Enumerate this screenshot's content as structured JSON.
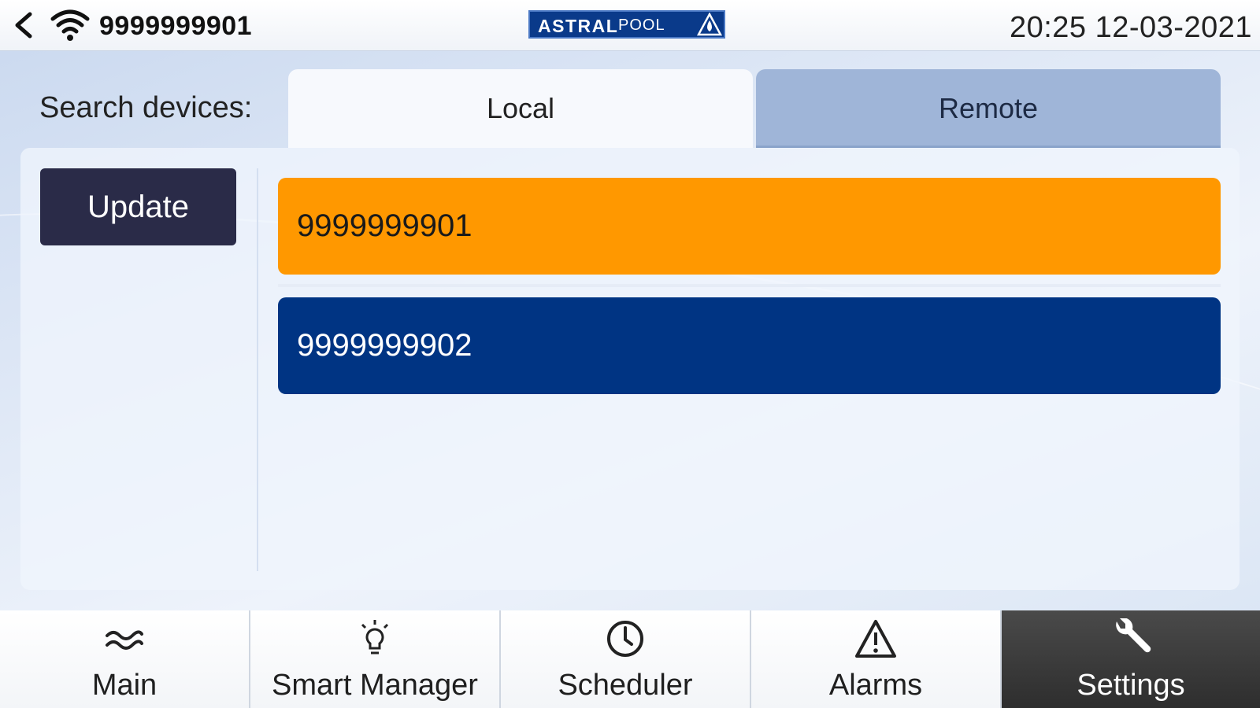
{
  "header": {
    "device_id": "9999999901",
    "logo_primary": "ASTRAL",
    "logo_secondary": "POOL",
    "datetime": "20:25 12-03-2021"
  },
  "search": {
    "label": "Search devices:",
    "tabs": [
      {
        "label": "Local",
        "selected": true
      },
      {
        "label": "Remote",
        "selected": false
      }
    ]
  },
  "actions": {
    "update_label": "Update"
  },
  "devices": [
    {
      "id": "9999999901",
      "state": "selected",
      "color": "#ff9800"
    },
    {
      "id": "9999999902",
      "state": "available",
      "color": "#003483"
    }
  ],
  "nav": [
    {
      "label": "Main",
      "icon": "waves-icon",
      "active": false
    },
    {
      "label": "Smart Manager",
      "icon": "lightbulb-icon",
      "active": false
    },
    {
      "label": "Scheduler",
      "icon": "clock-icon",
      "active": false
    },
    {
      "label": "Alarms",
      "icon": "warning-icon",
      "active": false
    },
    {
      "label": "Settings",
      "icon": "wrench-icon",
      "active": true
    }
  ],
  "colors": {
    "logo_bg": "#0a3a8a",
    "update_button": "#2a2b48",
    "tab_inactive": "#9fb5d8",
    "nav_active": "#333333"
  }
}
